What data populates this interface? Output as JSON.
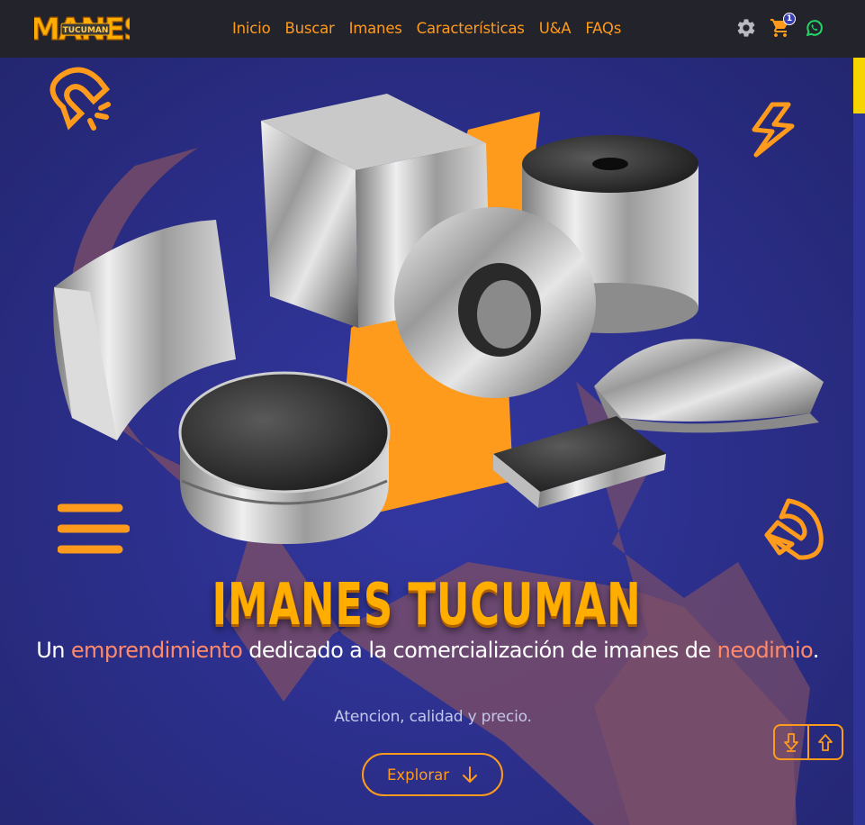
{
  "brand": {
    "logo_text": "IMANES",
    "logo_subtext": "TUCUMAN"
  },
  "nav": {
    "links": [
      "Inicio",
      "Buscar",
      "Imanes",
      "Características",
      "U&A",
      "FAQs"
    ]
  },
  "icons": {
    "settings": "gear-icon",
    "cart": "cart-icon",
    "whatsapp": "whatsapp-icon"
  },
  "cart": {
    "count": "1"
  },
  "hero": {
    "title": "IMANES TUCUMAN",
    "subtitle": {
      "part1": "Un ",
      "highlight1": "emprendimiento",
      "part2": " dedicado a la comercialización de imanes de ",
      "highlight2": "neodimio",
      "part3": "."
    },
    "tagline": "Atencion, calidad y precio.",
    "button_label": "Explorar"
  },
  "colors": {
    "accent": "#ff9b1c",
    "navbar": "#23232b",
    "hero_bg": "#2b2e85",
    "highlight": "#ff8a6b",
    "title": "#ffae00",
    "whatsapp": "#25d366",
    "scroll_thumb": "#f5d400"
  }
}
